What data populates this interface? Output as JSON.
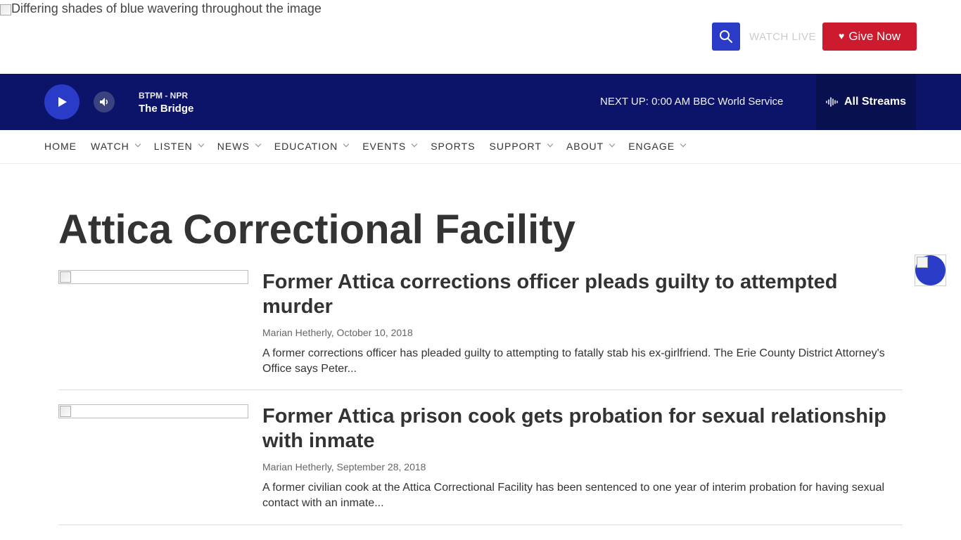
{
  "header": {
    "logo_alt": "Differing shades of blue wavering throughout the image",
    "watch_live": "WATCH LIVE",
    "give_now": "Give Now"
  },
  "player": {
    "station_line1": "BTPM - NPR",
    "station_line2": "The Bridge",
    "next_up": "NEXT UP: 0:00 AM BBC World Service",
    "all_streams": "All Streams"
  },
  "nav": {
    "items": [
      {
        "label": "HOME",
        "has_dropdown": false
      },
      {
        "label": "WATCH",
        "has_dropdown": true
      },
      {
        "label": "LISTEN",
        "has_dropdown": true
      },
      {
        "label": "NEWS",
        "has_dropdown": true
      },
      {
        "label": "EDUCATION",
        "has_dropdown": true
      },
      {
        "label": "EVENTS",
        "has_dropdown": true
      },
      {
        "label": "SPORTS",
        "has_dropdown": false
      },
      {
        "label": "SUPPORT",
        "has_dropdown": true
      },
      {
        "label": "ABOUT",
        "has_dropdown": true
      },
      {
        "label": "ENGAGE",
        "has_dropdown": true
      }
    ]
  },
  "page": {
    "title": "Attica Correctional Facility"
  },
  "articles": [
    {
      "headline": "Former Attica corrections officer pleads guilty to attempted murder",
      "byline": "Marian Hetherly, October 10, 2018",
      "teaser": "A former corrections officer has pleaded guilty to attempting to fatally stab his ex-girlfriend. The Erie County District Attorney's Office says Peter..."
    },
    {
      "headline": "Former Attica prison cook gets probation for sexual relationship with inmate",
      "byline": "Marian Hetherly, September 28, 2018",
      "teaser": "A former civilian cook at the Attica Correctional Facility has been sentenced to one year of interim probation for having sexual contact with an inmate..."
    }
  ],
  "colors": {
    "brand_blue": "#2a3bc7",
    "player_navy": "#0c1469",
    "give_red": "#cc1a2e"
  },
  "icons": {
    "search": "search-icon",
    "heart": "heart-icon",
    "play": "play-icon",
    "volume": "volume-icon",
    "streams": "audio-wave-icon"
  }
}
